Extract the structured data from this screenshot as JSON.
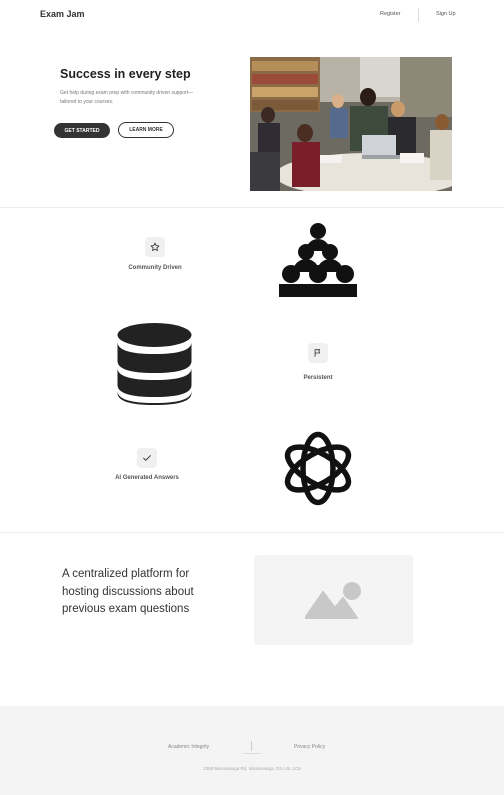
{
  "header": {
    "brand": "Exam Jam",
    "nav": {
      "register": "Register",
      "signup": "Sign Up"
    }
  },
  "hero": {
    "title": "Success in every step",
    "subtitle": "Get help during exam prep with community driven support—tailored to your courses.",
    "primary_button": "GET STARTED",
    "secondary_button": "LEARN MORE",
    "image": "students-studying-photo"
  },
  "features": [
    {
      "label": "Community Driven",
      "badge_icon": "star-icon",
      "illustration": "people-group-icon"
    },
    {
      "label": "Persistent",
      "badge_icon": "flag-icon",
      "illustration": "database-icon"
    },
    {
      "label": "AI Generated Answers",
      "badge_icon": "check-icon",
      "illustration": "openai-logo-icon"
    }
  ],
  "mission": {
    "text": "A centralized platform for hosting discussions about previous exam questions",
    "image": "image-placeholder-icon"
  },
  "footer": {
    "links": {
      "integrity": "Academic Integrity",
      "privacy": "Privacy Policy"
    },
    "address": "3359 Mississauga Rd, Mississauga, ON L5L 1C6"
  },
  "colors": {
    "primary": "#333333",
    "footer_bg": "#f4f4f4",
    "badge_bg": "#f0f0f0"
  }
}
